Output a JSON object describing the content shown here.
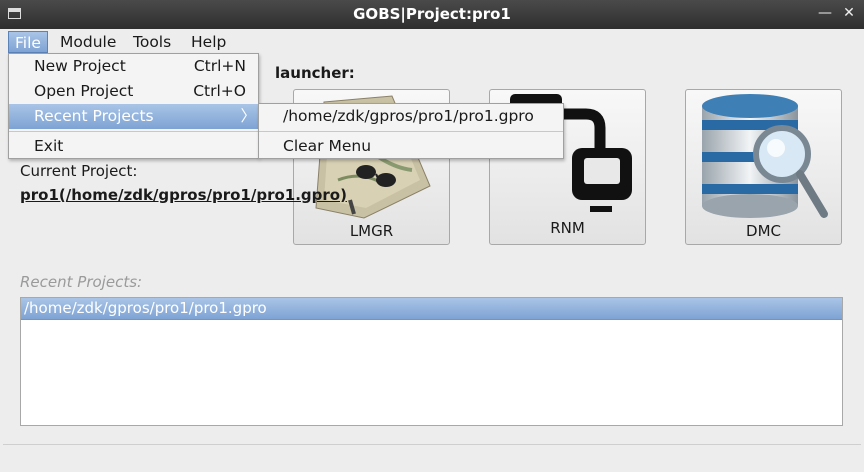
{
  "window": {
    "title": "GOBS|Project:pro1",
    "minimize_glyph": "—",
    "close_glyph": "✕"
  },
  "menubar": {
    "items": [
      "File",
      "Module",
      "Tools",
      "Help"
    ]
  },
  "file_menu": {
    "items": [
      {
        "label": "New Project",
        "shortcut": "Ctrl+N"
      },
      {
        "label": "Open Project",
        "shortcut": "Ctrl+O"
      },
      {
        "label": "Recent Projects",
        "arrow": "〉"
      },
      {
        "label": "Exit"
      }
    ]
  },
  "recent_submenu": {
    "items": [
      "/home/zdk/gpros/pro1/pro1.gpro",
      "Clear Menu"
    ]
  },
  "launcher": {
    "label": "launcher:",
    "tiles": [
      {
        "label": "LMGR",
        "icon": "map-icon"
      },
      {
        "label": "RNM",
        "icon": "network-icon"
      },
      {
        "label": "DMC",
        "icon": "database-search-icon"
      }
    ]
  },
  "current_project": {
    "label": "Current Project:",
    "value": "pro1(/home/zdk/gpros/pro1/pro1.gpro)"
  },
  "recent_projects": {
    "label": "Recent Projects:",
    "items": [
      "/home/zdk/gpros/pro1/pro1.gpro"
    ]
  },
  "colors": {
    "selection": "#7ea3d4",
    "titlebar": "#2e2e2e",
    "background": "#ededed"
  }
}
